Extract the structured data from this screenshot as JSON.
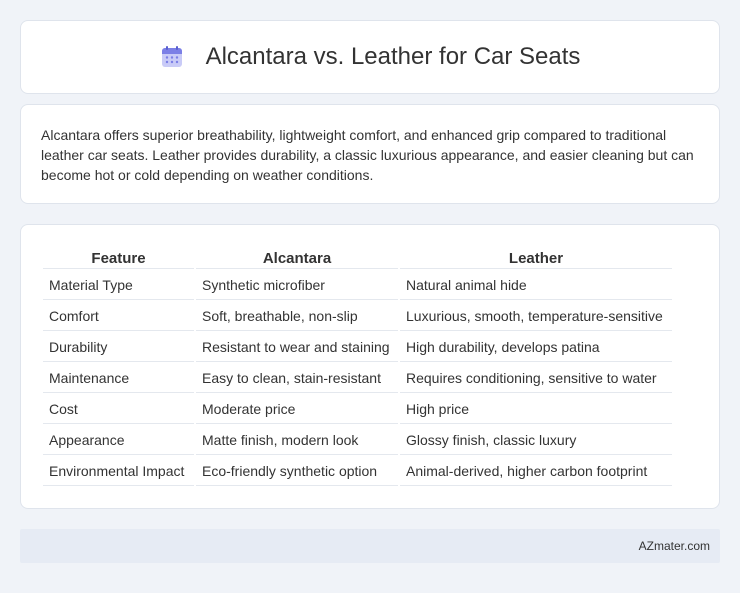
{
  "header": {
    "title": "Alcantara vs. Leather for Car Seats",
    "icon": "calendar-icon",
    "icon_color": "#7b7fe6"
  },
  "intro": {
    "text": "Alcantara offers superior breathability, lightweight comfort, and enhanced grip compared to traditional leather car seats. Leather provides durability, a classic luxurious appearance, and easier cleaning but can become hot or cold depending on weather conditions."
  },
  "table": {
    "headers": [
      "Feature",
      "Alcantara",
      "Leather"
    ],
    "rows": [
      [
        "Material Type",
        "Synthetic microfiber",
        "Natural animal hide"
      ],
      [
        "Comfort",
        "Soft, breathable, non-slip",
        "Luxurious, smooth, temperature-sensitive"
      ],
      [
        "Durability",
        "Resistant to wear and staining",
        "High durability, develops patina"
      ],
      [
        "Maintenance",
        "Easy to clean, stain-resistant",
        "Requires conditioning, sensitive to water"
      ],
      [
        "Cost",
        "Moderate price",
        "High price"
      ],
      [
        "Appearance",
        "Matte finish, modern look",
        "Glossy finish, classic luxury"
      ],
      [
        "Environmental Impact",
        "Eco-friendly synthetic option",
        "Animal-derived, higher carbon footprint"
      ]
    ]
  },
  "footer": {
    "brand": "AZmater.com"
  }
}
